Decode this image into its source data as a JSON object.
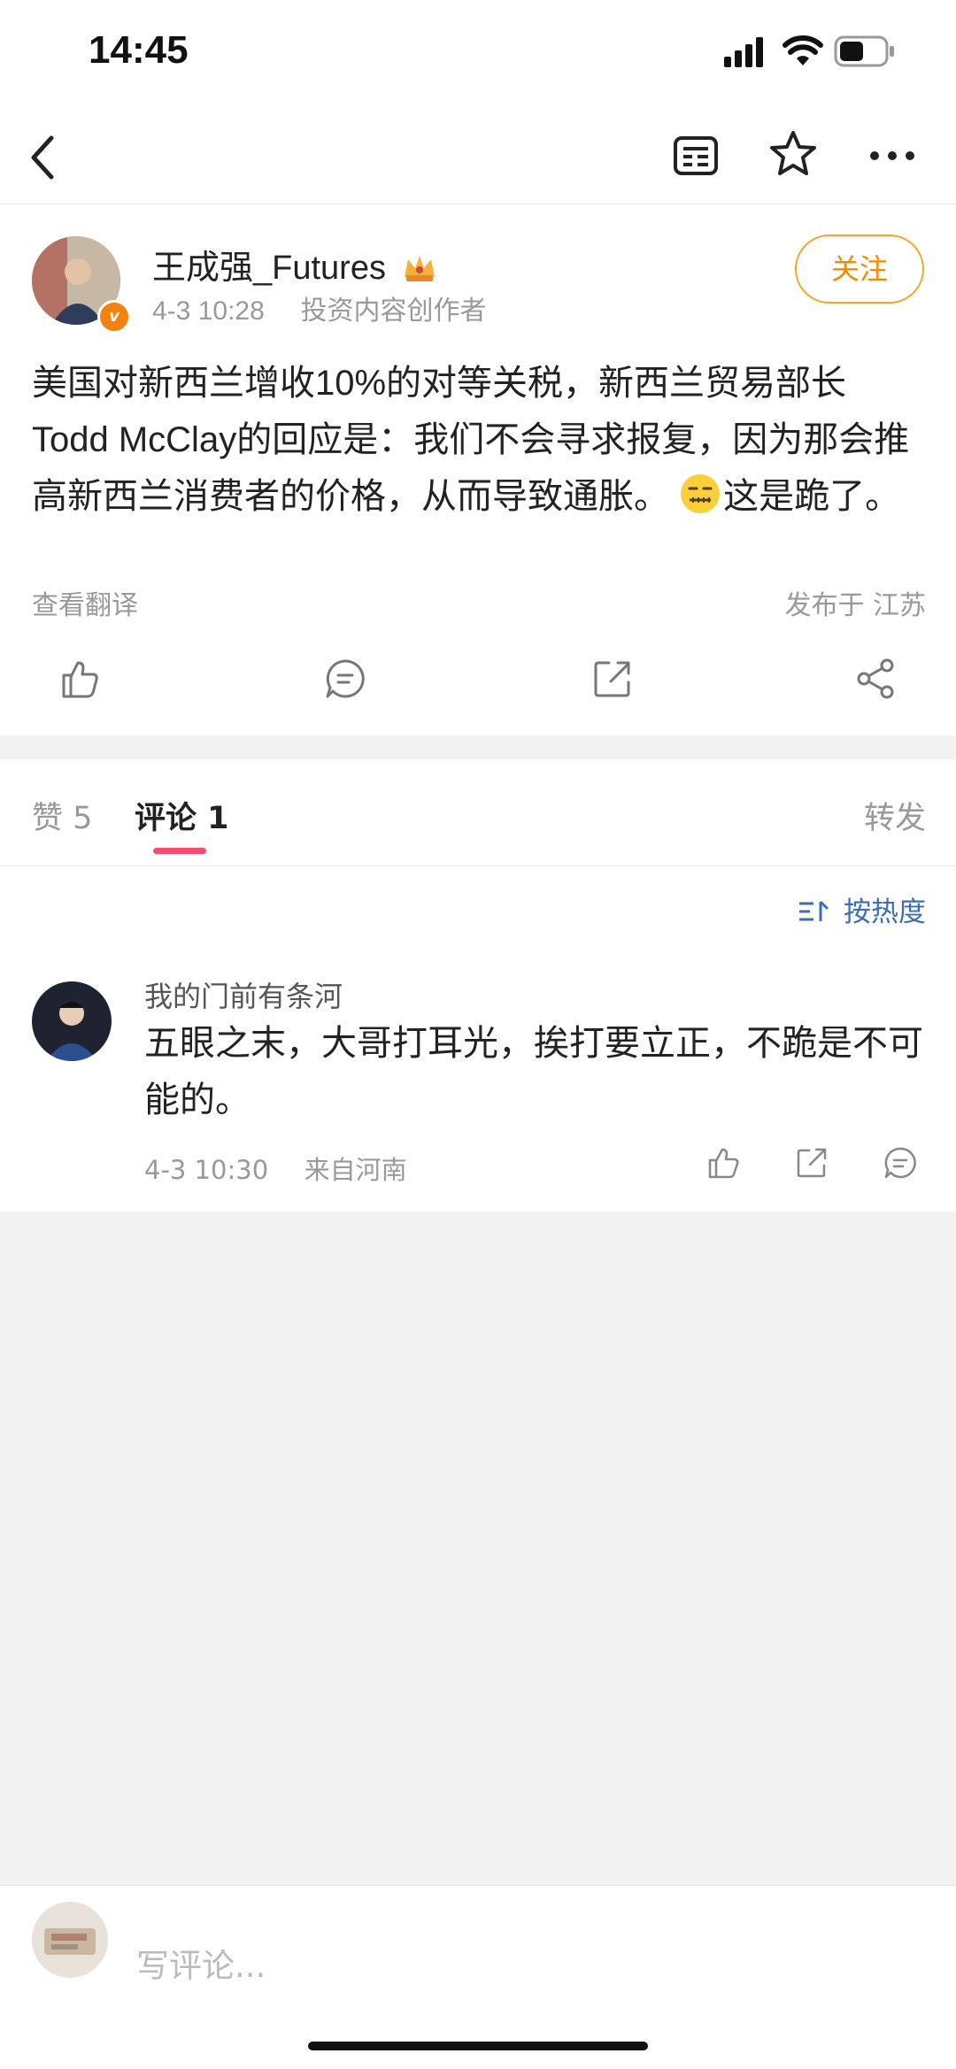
{
  "status_bar": {
    "time": "14:45"
  },
  "nav": {
    "back_icon": "chevron-left-icon",
    "article_icon": "article-list-icon",
    "favorite_icon": "star-icon",
    "more_icon": "more-icon"
  },
  "post": {
    "author": "王成强_Futures",
    "timestamp": "4-3 10:28",
    "author_role": "投资内容创作者",
    "follow_label": "关注",
    "text_main": "美国对新西兰增收10%的对等关税，新西兰贸易部长 Todd McClay的回应是：我们不会寻求报复，因为那会推高新西兰消费者的价格，从而导致通胀。",
    "text_tail": "这是跪了。",
    "view_translation": "查看翻译",
    "location": "发布于 江苏"
  },
  "tabs": {
    "likes": "赞 5",
    "comments": "评论 1",
    "reposts": "转发"
  },
  "comments": {
    "sort_label": "按热度",
    "items": [
      {
        "name": "我的门前有条河",
        "text": "五眼之末，大哥打耳光，挨打要立正，不跪是不可能的。",
        "timestamp": "4-3 10:30",
        "location": "来自河南"
      }
    ]
  },
  "bottom_bar": {
    "placeholder": "写评论..."
  },
  "colors": {
    "accent_orange": "#f5a623",
    "tab_indicator": "#f0506e",
    "link_blue": "#3d6db5"
  }
}
